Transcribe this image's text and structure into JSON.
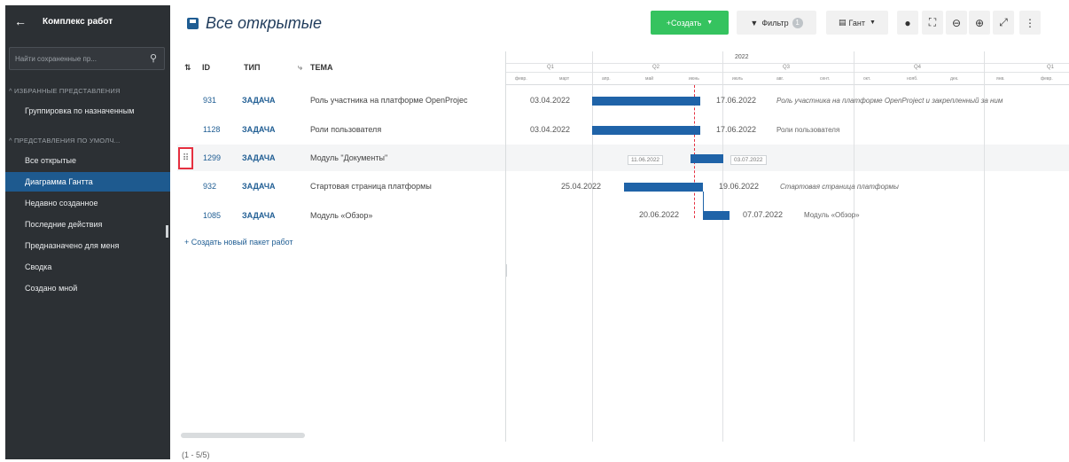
{
  "sidebar": {
    "title": "Комплекс работ",
    "search_placeholder": "Найти сохраненные пр...",
    "section_favorites": "ИЗБРАННЫЕ ПРЕДСТАВЛЕНИЯ",
    "section_defaults": "ПРЕДСТАВЛЕНИЯ ПО УМОЛЧ...",
    "items": [
      {
        "label": "Группировка по назначенным"
      },
      {
        "label": "Все открытые"
      },
      {
        "label": "Диаграмма Гантта"
      },
      {
        "label": "Недавно созданное"
      },
      {
        "label": "Последние действия"
      },
      {
        "label": "Предназначено для меня"
      },
      {
        "label": "Сводка"
      },
      {
        "label": "Создано мной"
      }
    ]
  },
  "toolbar": {
    "page_title": "Все открытые",
    "create_label": "+Создать",
    "filter_label": "Фильтр",
    "filter_count": "1",
    "gantt_label": "Гант"
  },
  "table": {
    "headers": {
      "id": "ID",
      "type": "ТИП",
      "subject": "ТЕМА"
    },
    "rows": [
      {
        "id": "931",
        "type": "ЗАДАЧА",
        "subject": "Роль участника на платформе OpenProjec"
      },
      {
        "id": "1128",
        "type": "ЗАДАЧА",
        "subject": "Роли пользователя"
      },
      {
        "id": "1299",
        "type": "ЗАДАЧА",
        "subject": "Модуль \"Документы\""
      },
      {
        "id": "932",
        "type": "ЗАДАЧА",
        "subject": "Стартовая страница платформы"
      },
      {
        "id": "1085",
        "type": "ЗАДАЧА",
        "subject": "Модуль «Обзор»"
      }
    ],
    "create_new": "+ Создать новый пакет работ",
    "pagination": "(1 - 5/5)"
  },
  "gantt": {
    "year": "2022",
    "quarters": [
      "Q1",
      "Q2",
      "Q3",
      "Q4",
      "Q1"
    ],
    "months": [
      "февр.",
      "март",
      "апр.",
      "май",
      "июнь",
      "июль",
      "авг.",
      "сент.",
      "окт.",
      "нояб.",
      "дек.",
      "янв.",
      "февр."
    ],
    "rows": [
      {
        "start": "03.04.2022",
        "end": "17.06.2022",
        "subject": "Роль участника на платформе OpenProject и закрепленный за ним"
      },
      {
        "start": "03.04.2022",
        "end": "17.06.2022",
        "subject": "Роли пользователя"
      },
      {
        "start": "11.06.2022",
        "end": "03.07.2022",
        "subject": ""
      },
      {
        "start": "25.04.2022",
        "end": "19.06.2022",
        "subject": "Стартовая страница платформы"
      },
      {
        "start": "20.06.2022",
        "end": "07.07.2022",
        "subject": "Модуль «Обзор»"
      }
    ]
  }
}
